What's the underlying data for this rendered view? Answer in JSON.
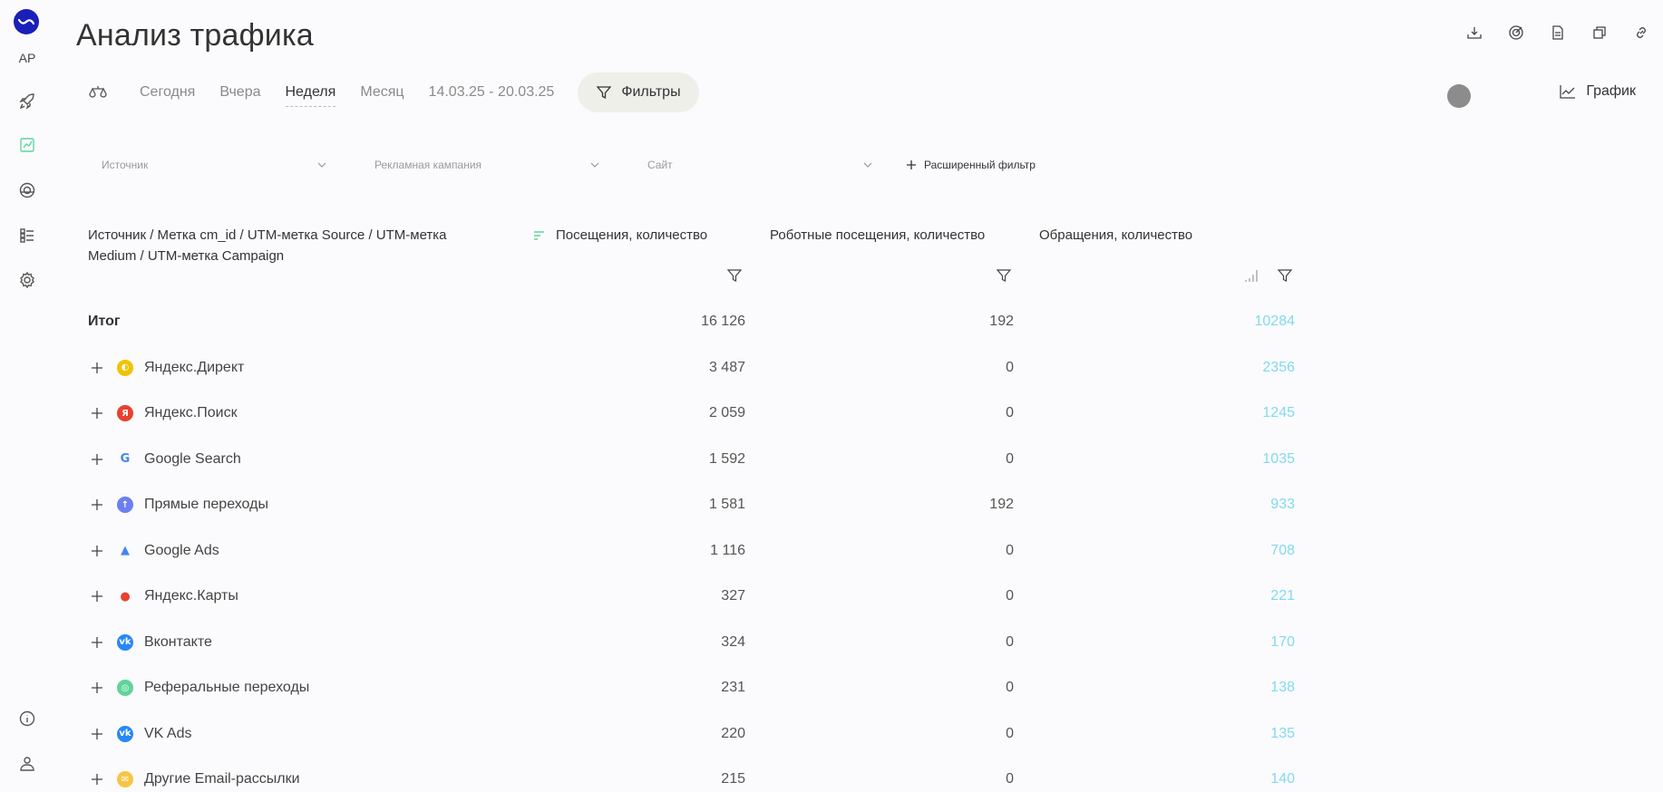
{
  "sidebar": {
    "user_initials": "AP"
  },
  "header": {
    "title": "Анализ трафика"
  },
  "periods": [
    "Сегодня",
    "Вчера",
    "Неделя",
    "Месяц"
  ],
  "active_period": "Неделя",
  "date_range": "14.03.25 - 20.03.25",
  "filters_label": "Фильтры",
  "chart_label": "График",
  "dropdowns": {
    "source": "Источник",
    "campaign": "Рекламная кампания",
    "site": "Сайт"
  },
  "advanced_filter": "Расширенный фильтр",
  "columns": {
    "dimension": "Источник / Метка cm_id / UTM-метка Source / UTM-метка Medium / UTM-метка Campaign",
    "visits": "Посещения, количество",
    "robot_visits": "Роботные посещения, количество",
    "leads": "Обращения, количество"
  },
  "total": {
    "label": "Итог",
    "visits": "16 126",
    "robot_visits": "192",
    "leads": "10284"
  },
  "rows": [
    {
      "name": "Яндекс.Директ",
      "visits": "3 487",
      "robot_visits": "0",
      "leads": "2356",
      "icon": "yandex-direct-icon",
      "color": "#f2c200"
    },
    {
      "name": "Яндекс.Поиск",
      "visits": "2 059",
      "robot_visits": "0",
      "leads": "1245",
      "icon": "yandex-search-icon",
      "color": "#e8412f"
    },
    {
      "name": "Google Search",
      "visits": "1 592",
      "robot_visits": "0",
      "leads": "1035",
      "icon": "google-icon",
      "color": "#4285f4"
    },
    {
      "name": "Прямые переходы",
      "visits": "1 581",
      "robot_visits": "192",
      "leads": "933",
      "icon": "direct-arrow-icon",
      "color": "#6b7ff0"
    },
    {
      "name": "Google Ads",
      "visits": "1 116",
      "robot_visits": "0",
      "leads": "708",
      "icon": "google-ads-icon",
      "color": "#fbbc04"
    },
    {
      "name": "Яндекс.Карты",
      "visits": "327",
      "robot_visits": "0",
      "leads": "221",
      "icon": "map-pin-icon",
      "color": "#e8412f"
    },
    {
      "name": "Вконтакте",
      "visits": "324",
      "robot_visits": "0",
      "leads": "170",
      "icon": "vk-icon",
      "color": "#2787f5"
    },
    {
      "name": "Реферальные переходы",
      "visits": "231",
      "robot_visits": "0",
      "leads": "138",
      "icon": "referral-icon",
      "color": "#5fd49a"
    },
    {
      "name": "VK Ads",
      "visits": "220",
      "robot_visits": "0",
      "leads": "135",
      "icon": "vk-ads-icon",
      "color": "#2787f5"
    },
    {
      "name": "Другие Email-рассылки",
      "visits": "215",
      "robot_visits": "0",
      "leads": "140",
      "icon": "email-icon",
      "color": "#f7c544"
    }
  ],
  "colors": {
    "brand": "#1a1fb8",
    "link_values": "#82d9f0",
    "active_sidebar": "#5fd49a"
  }
}
